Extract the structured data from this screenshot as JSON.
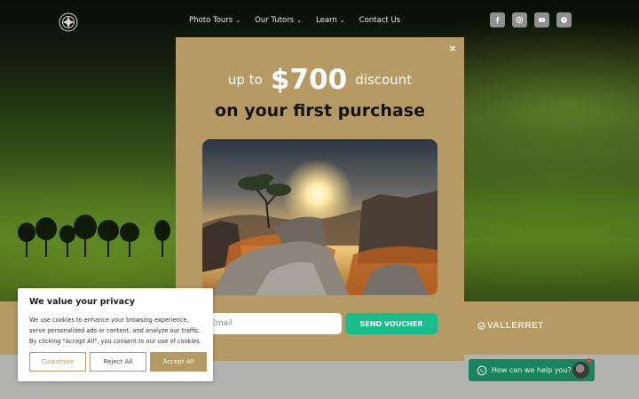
{
  "nav": {
    "items": [
      {
        "label": "Photo Tours",
        "has_dropdown": true
      },
      {
        "label": "Our Tutors",
        "has_dropdown": true
      },
      {
        "label": "Learn",
        "has_dropdown": true
      },
      {
        "label": "Contact Us",
        "has_dropdown": false
      }
    ],
    "dropdown_glyph": "⌄"
  },
  "social": {
    "icons": [
      "facebook-icon",
      "instagram-icon",
      "youtube-icon",
      "pinterest-icon"
    ]
  },
  "popup": {
    "close_glyph": "×",
    "prefix": "up to",
    "amount": "$700",
    "suffix": "discount",
    "subtitle": "on your first purchase",
    "email_placeholder": "Email",
    "send_label": "SEND VOUCHER"
  },
  "brand_strip": {
    "logo_text": "VALLERRET"
  },
  "cookie": {
    "title": "We value your privacy",
    "text_lines": [
      "We use cookies to enhance your browsing experience,",
      "serve personalized ads or content, and analyze our traffic.",
      "By clicking \"Accept All\", you consent to our use of cookies."
    ],
    "customize_label": "Customize",
    "reject_label": "Reject All",
    "accept_label": "Accept All"
  },
  "chat": {
    "label": "How can we help you?"
  },
  "colors": {
    "popup_bg": "#b69a64",
    "send_button": "#17bd8a",
    "chat_bg": "#19855f",
    "accent_gold": "#b69a64"
  }
}
